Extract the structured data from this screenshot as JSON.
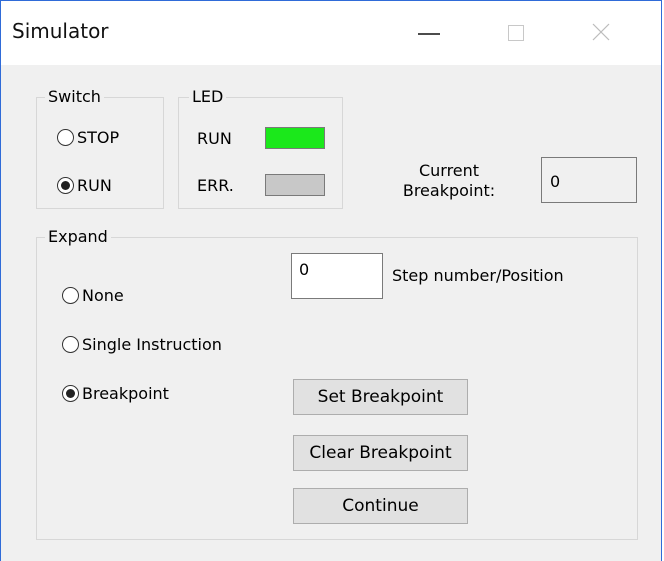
{
  "window": {
    "title": "Simulator"
  },
  "switch_group": {
    "legend": "Switch",
    "options": [
      {
        "label": "STOP",
        "selected": false
      },
      {
        "label": "RUN",
        "selected": true
      }
    ]
  },
  "led_group": {
    "legend": "LED",
    "indicators": [
      {
        "label": "RUN",
        "color": "#1be81b"
      },
      {
        "label": "ERR.",
        "color": "#c8c8c8"
      }
    ]
  },
  "breakpoint_display": {
    "label_line1": "Current",
    "label_line2": "Breakpoint:",
    "value": "0"
  },
  "expand_group": {
    "legend": "Expand",
    "options": [
      {
        "label": "None",
        "selected": false
      },
      {
        "label": "Single Instruction",
        "selected": false
      },
      {
        "label": "Breakpoint",
        "selected": true
      }
    ],
    "step_input": {
      "value": "0",
      "label": "Step number/Position"
    },
    "buttons": {
      "set": "Set Breakpoint",
      "clear": "Clear Breakpoint",
      "continue": "Continue"
    }
  }
}
